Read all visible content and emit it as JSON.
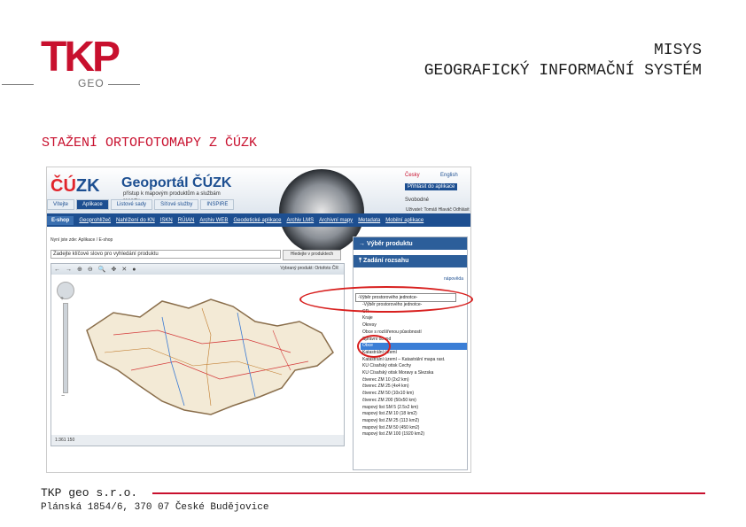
{
  "logo": {
    "brand": "TKP",
    "sub": "GEO"
  },
  "header": {
    "line1": "MISYS",
    "line2": "GEOGRAFICKÝ INFORMAČNÍ SYSTÉM"
  },
  "section_title": "STAŽENÍ ORTOFOTOMAPY Z ČÚZK",
  "screenshot": {
    "logo_text_a": "ČÚ",
    "logo_text_b": "ZK",
    "portal_title": "Geoportál ČÚZK",
    "portal_subtitle": "přístup k mapovým produktům a službám resortu",
    "lang_cz": "Česky",
    "lang_en": "English",
    "login": "Přihlásit do aplikace",
    "svoboda": "Svobodné",
    "tabs": [
      "Vítejte",
      "Aplikace",
      "Listové sady",
      "Síťové služby",
      "INSPIRE"
    ],
    "user_line": "Uživatel: Tomáš Hlaváč  Odhlásit",
    "menu": [
      "E-shop",
      "Geoprohlížeč",
      "Nahlížení do KN",
      "ISKN",
      "RÚIAN",
      "Archiv WEB",
      "Geodetické aplikace",
      "Archiv LMS",
      "Archivní mapy",
      "Metadata",
      "Mobilní aplikace"
    ],
    "breadcrumb": "Nyní jste zde: Aplikace / E-shop",
    "search_placeholder": "Zadejte klíčové slovo pro vyhledání produktu",
    "search_button": "Hledejte v produktech",
    "selected_product": "Vybraný produkt: Ortofoto ČR",
    "scale": "1:361 150",
    "panel_head1": "→ Výběr produktu",
    "panel_head2": "⤒ Zadání rozsahu",
    "panel_tools": "nápověda",
    "select_value": "-Výběr prostorového jednotce-",
    "dropdown": [
      "-Výběr prostorového jednotce-",
      "ČR",
      "Kraje",
      "Okresy",
      "Obce s rozšířenou působností",
      "Správní obvod",
      "Obce",
      "Katastrální území",
      "Katastrální území – Katastrální mapa rast.",
      "KÚ Císařský otisk Čechy",
      "KÚ Císařský otisk Moravy a Slezska",
      "čtverec ZM 10 (2x2 km)",
      "čtverec ZM 25 (4x4 km)",
      "čtverec ZM 50 (10x10 km)",
      "čtverec ZM 200 (50x50 km)",
      "mapový list SM 5 (2.5x2 km)",
      "mapový list ZM 10 (18 km2)",
      "mapový list ZM 25 (113 km2)",
      "mapový list ZM 50 (450 km2)",
      "mapový list ZM 100 (1920 km2)"
    ],
    "dropdown_selected_index": 6,
    "map_tools": [
      "←",
      "→",
      "⊕",
      "⊖",
      "🔍",
      "✥",
      "✕",
      "●"
    ]
  },
  "footer": {
    "company": "TKP geo s.r.o.",
    "address": "Plánská 1854/6, 370 07 České Budějovice"
  },
  "colors": {
    "brand_red": "#c8102e",
    "cuzk_blue": "#1d4f91",
    "highlight": "#d8201f"
  }
}
